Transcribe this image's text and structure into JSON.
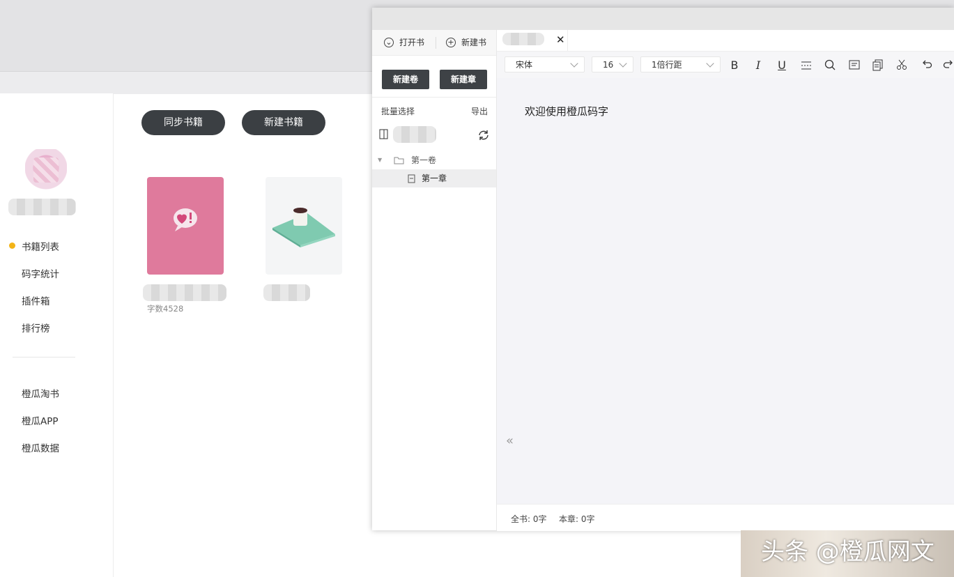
{
  "sidebar": {
    "nav": [
      {
        "label": "书籍列表",
        "active": true
      },
      {
        "label": "码字统计"
      },
      {
        "label": "插件箱"
      },
      {
        "label": "排行榜"
      }
    ],
    "links": [
      {
        "label": "橙瓜淘书"
      },
      {
        "label": "橙瓜APP"
      },
      {
        "label": "橙瓜数据"
      }
    ],
    "active_dot_color": "#f3b417"
  },
  "main": {
    "sync_button": "同步书籍",
    "new_book_button": "新建书籍",
    "books": [
      {
        "word_count": "字数4528",
        "cover_color": "#df7a9c",
        "cover_icon": "heart-speech-bubble-icon"
      },
      {
        "cover_color": "#f4f5f6",
        "cover_icon": "book-coffee-icon"
      }
    ]
  },
  "editor": {
    "toolbar": {
      "open_book": "打开书",
      "new_book": "新建书"
    },
    "new_volume": "新建卷",
    "new_chapter": "新建章",
    "batch_select": "批量选择",
    "export": "导出",
    "tree": {
      "volume": "第一卷",
      "chapter": "第一章"
    },
    "format": {
      "font": "宋体",
      "size": "16",
      "line_spacing": "1倍行距"
    },
    "tools": [
      "bold-icon",
      "italic-icon",
      "underline-icon",
      "divider-icon",
      "search-icon",
      "notes-icon",
      "copy-icon",
      "scissors-icon",
      "undo-icon",
      "redo-icon"
    ],
    "doc_text": "欢迎使用橙瓜码字",
    "status": {
      "book_total": "全书: 0字",
      "chapter_total": "本章: 0字"
    }
  },
  "watermark": "头条 @橙瓜网文"
}
